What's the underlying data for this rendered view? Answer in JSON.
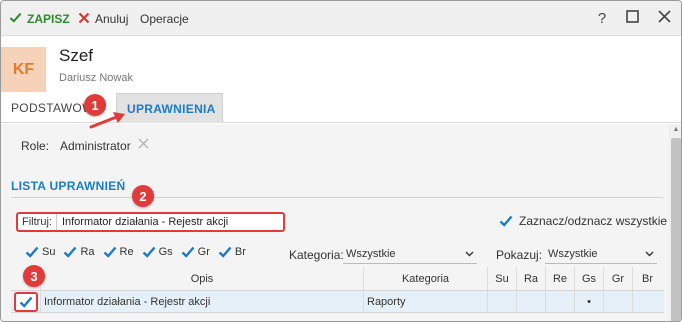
{
  "toolbar": {
    "save_label": "ZAPISZ",
    "cancel_label": "Anuluj",
    "operations_label": "Operacje",
    "help_glyph": "?",
    "accent_green": "#2e8b2e",
    "cancel_red": "#d9322f"
  },
  "header": {
    "avatar_initials": "KF",
    "title": "Szef",
    "subtitle": "Dariusz Nowak"
  },
  "tabs": [
    {
      "label": "PODSTAWOWE",
      "active": false
    },
    {
      "label": "UPRAWNIENIA",
      "active": true
    }
  ],
  "role": {
    "label": "Role:",
    "value": "Administrator"
  },
  "section": {
    "title": "LISTA UPRAWNIEŃ"
  },
  "filter": {
    "label": "Filtruj:",
    "value": "Informator działania - Rejestr akcji"
  },
  "select_all": {
    "label": "Zaznacz/odznacz wszystkie",
    "checked": true
  },
  "permissions": [
    {
      "label": "Su",
      "checked": true
    },
    {
      "label": "Ra",
      "checked": true
    },
    {
      "label": "Re",
      "checked": true
    },
    {
      "label": "Gs",
      "checked": true
    },
    {
      "label": "Gr",
      "checked": true
    },
    {
      "label": "Br",
      "checked": true
    }
  ],
  "category_filter": {
    "label": "Kategoria:",
    "value": "Wszystkie"
  },
  "show_filter": {
    "label": "Pokazuj:",
    "value": "Wszystkie"
  },
  "table": {
    "headers": [
      "Opis",
      "Kategoria",
      "Su",
      "Ra",
      "Re",
      "Gs",
      "Gr",
      "Br"
    ],
    "rows": [
      {
        "checked": true,
        "description": "Informator działania - Rejestr akcji",
        "category": "Raporty",
        "su": "",
        "ra": "",
        "re": "",
        "gs": "•",
        "gr": "",
        "br": ""
      }
    ]
  },
  "annotations": {
    "marker1": "1",
    "marker2": "2",
    "marker3": "3",
    "color": "#e03b3b"
  },
  "colors": {
    "accent_blue": "#1d7cc1",
    "check_blue": "#1d7cc1"
  }
}
